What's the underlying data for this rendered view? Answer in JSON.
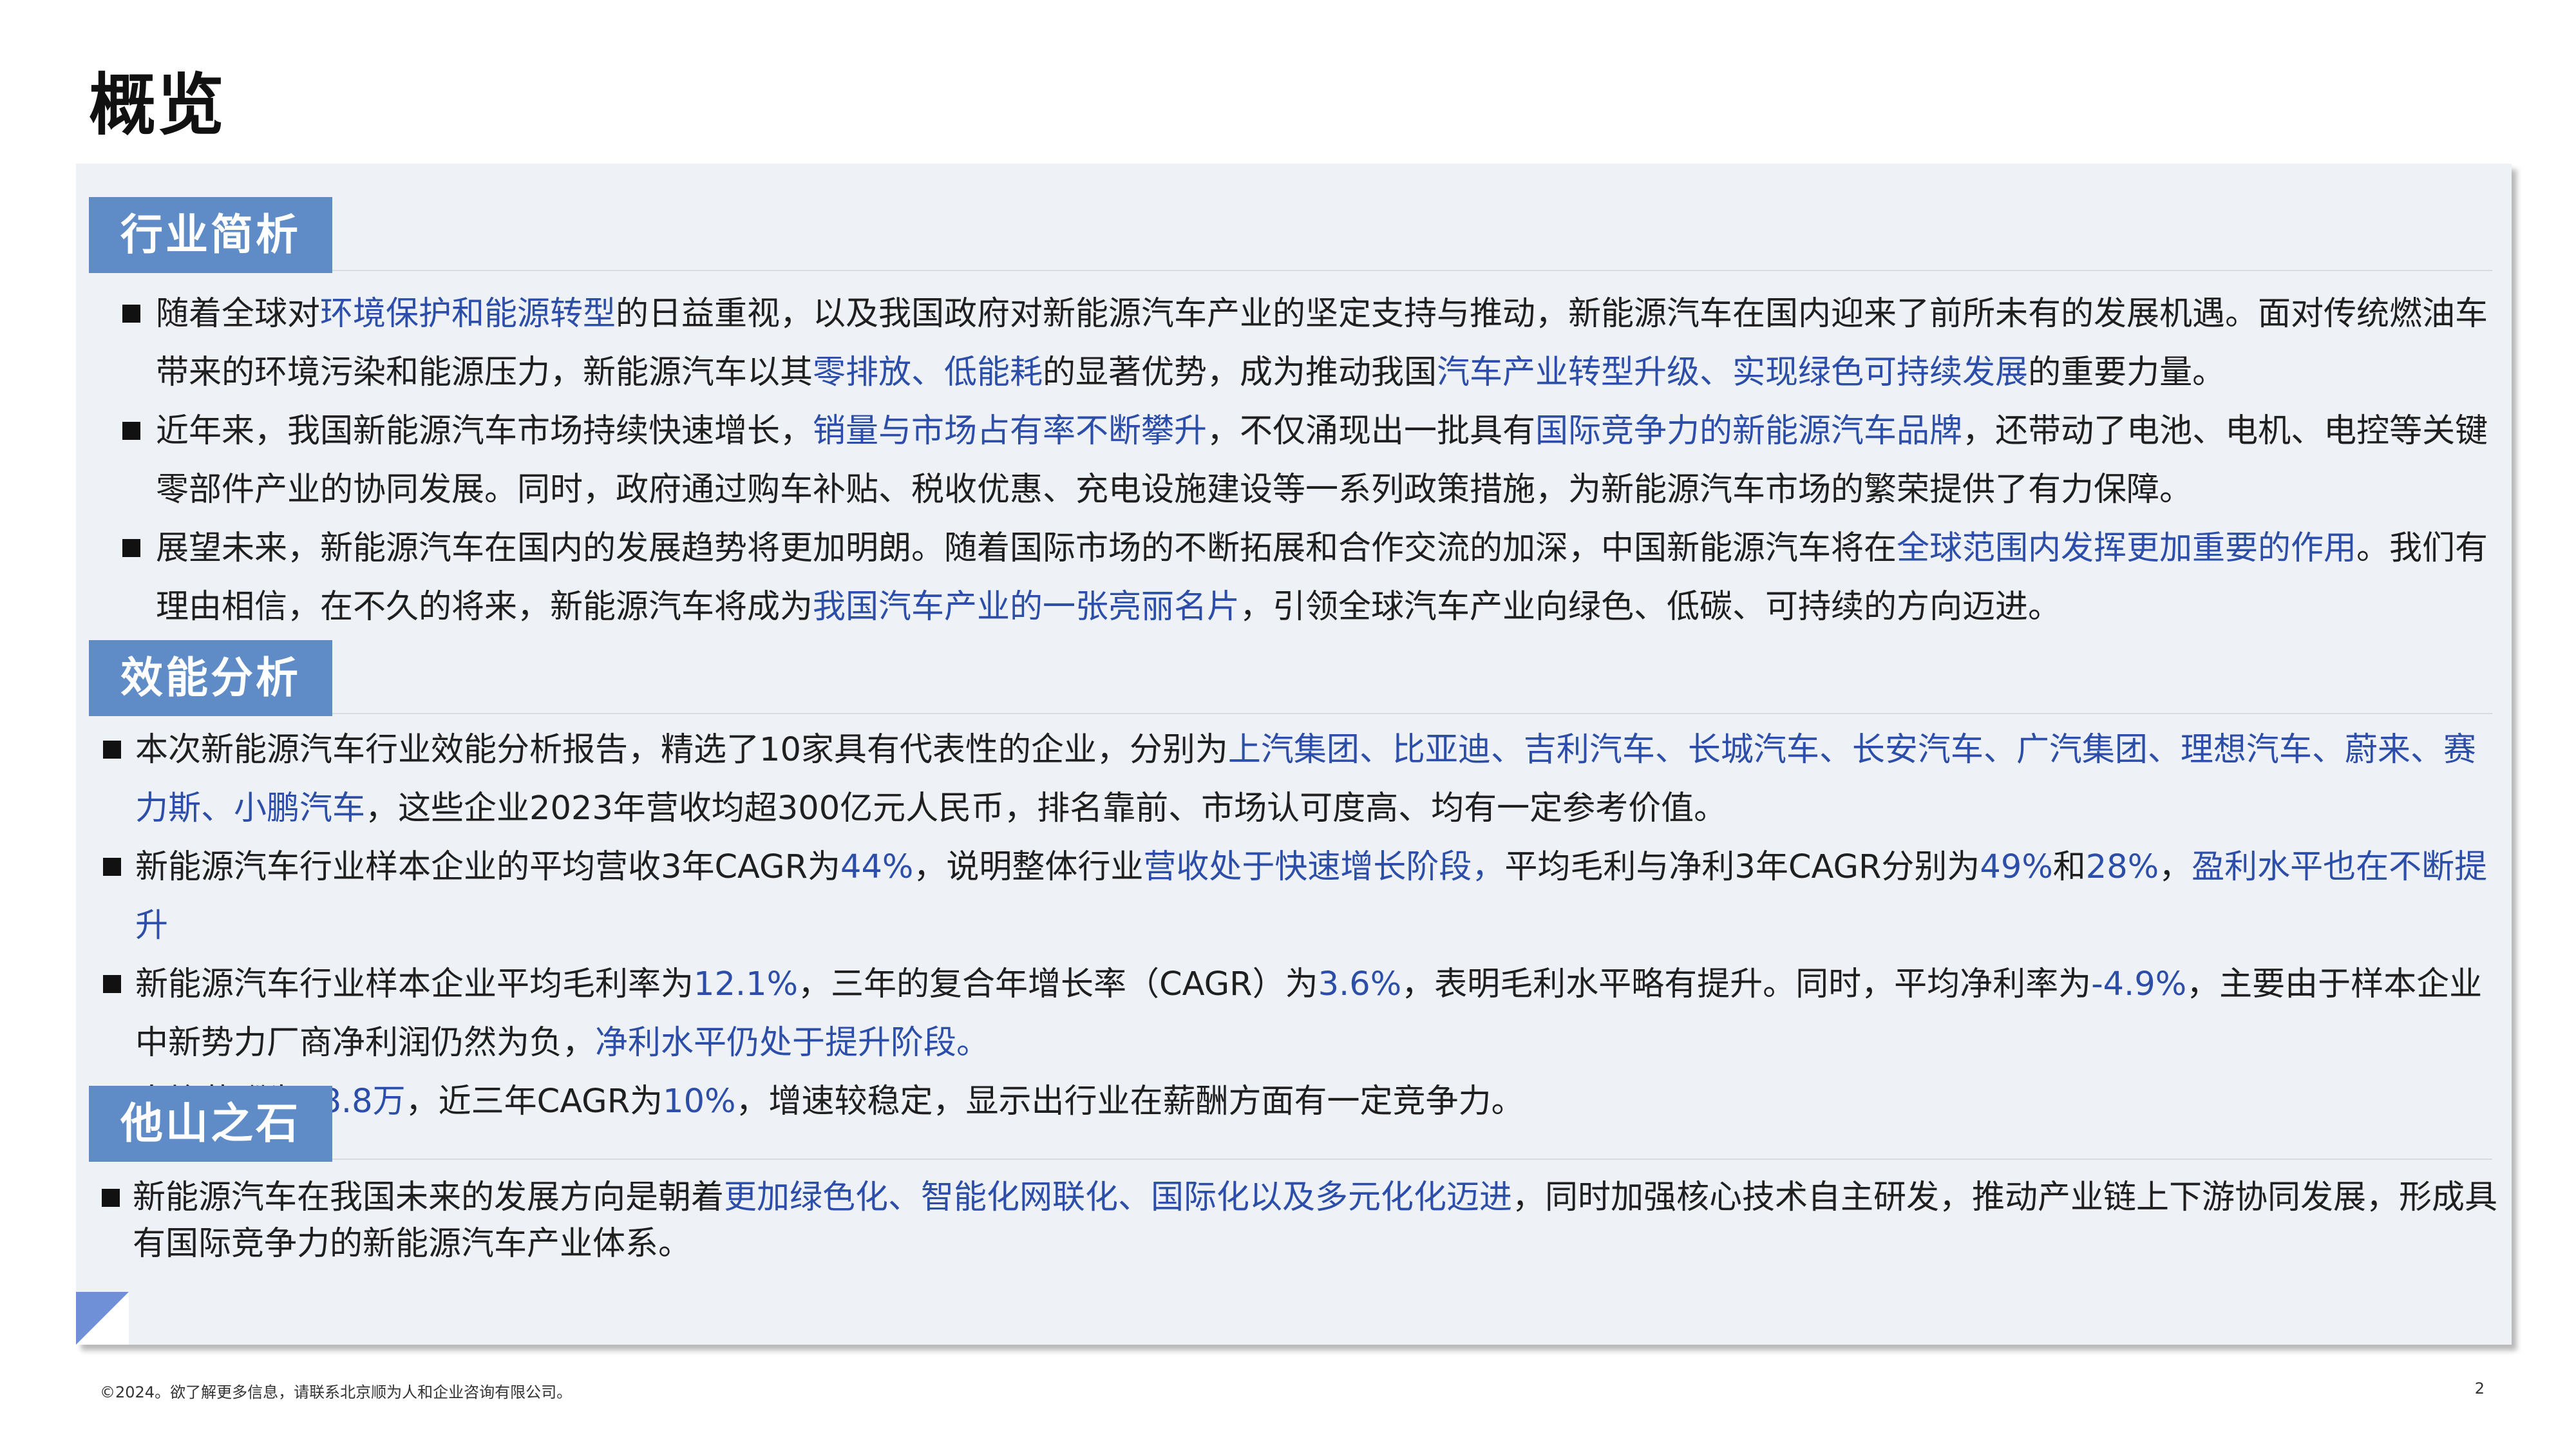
{
  "page": {
    "title": "概览"
  },
  "sections": [
    {
      "heading": "行业简析",
      "bullets": [
        [
          {
            "t": "随着全球对",
            "hl": false
          },
          {
            "t": "环境保护和能源转型",
            "hl": true
          },
          {
            "t": "的日益重视，以及我国政府对新能源汽车产业的坚定支持与推动，新能源汽车在国内迎来了前所未有的发展机遇。面对传统燃油车带来的环境污染和能源压力，新能源汽车以其",
            "hl": false
          },
          {
            "t": "零排放、低能耗",
            "hl": true
          },
          {
            "t": "的显著优势，成为推动我国",
            "hl": false
          },
          {
            "t": "汽车产业转型升级、实现绿色可持续发展",
            "hl": true
          },
          {
            "t": "的重要力量。",
            "hl": false
          }
        ],
        [
          {
            "t": "近年来，我国新能源汽车市场持续快速增长，",
            "hl": false
          },
          {
            "t": "销量与市场占有率不断攀升",
            "hl": true
          },
          {
            "t": "，不仅涌现出一批具有",
            "hl": false
          },
          {
            "t": "国际竞争力的新能源汽车品牌",
            "hl": true
          },
          {
            "t": "，还带动了电池、电机、电控等关键零部件产业的协同发展。同时，政府通过购车补贴、税收优惠、充电设施建设等一系列政策措施，为新能源汽车市场的繁荣提供了有力保障。",
            "hl": false
          }
        ],
        [
          {
            "t": "展望未来，新能源汽车在国内的发展趋势将更加明朗。随着国际市场的不断拓展和合作交流的加深，中国新能源汽车将在",
            "hl": false
          },
          {
            "t": "全球范围内发挥更加重要的作用",
            "hl": true
          },
          {
            "t": "。我们有理由相信，在不久的将来，新能源汽车将成为",
            "hl": false
          },
          {
            "t": "我国汽车产业的一张亮丽名片",
            "hl": true
          },
          {
            "t": "，引领全球汽车产业向绿色、低碳、可持续的方向迈进。",
            "hl": false
          }
        ]
      ]
    },
    {
      "heading": "效能分析",
      "bullets": [
        [
          {
            "t": "本次新能源汽车行业效能分析报告，精选了10家具有代表性的企业，分别为",
            "hl": false
          },
          {
            "t": "上汽集团、比亚迪、吉利汽车、长城汽车、长安汽车、广汽集团、理想汽车、蔚来、赛力斯、小鹏汽车",
            "hl": true
          },
          {
            "t": "，这些企业2023年营收均超300亿元人民币，排名靠前、市场认可度高、均有一定参考价值。",
            "hl": false
          }
        ],
        [
          {
            "t": "新能源汽车行业样本企业的平均营收3年CAGR为",
            "hl": false
          },
          {
            "t": "44%",
            "hl": true
          },
          {
            "t": "，说明整体行业",
            "hl": false
          },
          {
            "t": "营收处于快速增长阶段，",
            "hl": true
          },
          {
            "t": "平均毛利与净利3年CAGR分别为",
            "hl": false
          },
          {
            "t": "49%",
            "hl": true
          },
          {
            "t": "和",
            "hl": false
          },
          {
            "t": "28%",
            "hl": true
          },
          {
            "t": "，",
            "hl": false
          },
          {
            "t": "盈利水平也在不断提升",
            "hl": true
          }
        ],
        [
          {
            "t": "新能源汽车行业样本企业平均毛利率为",
            "hl": false
          },
          {
            "t": "12.1%",
            "hl": true
          },
          {
            "t": "，三年的复合年增长率（CAGR）为",
            "hl": false
          },
          {
            "t": "3.6%",
            "hl": true
          },
          {
            "t": "，表明毛利水平略有提升。同时，平均净利率为",
            "hl": false
          },
          {
            "t": "-4.9%",
            "hl": true
          },
          {
            "t": "，主要由于样本企业中新势力厂商净利润仍然为负，",
            "hl": false
          },
          {
            "t": "净利水平仍处于提升阶段。",
            "hl": true
          }
        ],
        [
          {
            "t": "人均薪酬为",
            "hl": false
          },
          {
            "t": "28.8万",
            "hl": true
          },
          {
            "t": "，近三年CAGR为",
            "hl": false
          },
          {
            "t": "10%",
            "hl": true
          },
          {
            "t": "，增速较稳定，显示出行业在薪酬方面有一定竞争力。",
            "hl": false
          }
        ]
      ]
    },
    {
      "heading": "他山之石",
      "bullets": [
        [
          {
            "t": "新能源汽车在我国未来的发展方向是朝着",
            "hl": false
          },
          {
            "t": "更加绿色化、智能化网联化、国际化以及多元化化迈进",
            "hl": true
          },
          {
            "t": "，同时加强核心技术自主研发，推动产业链上下游协同发展，形成具有国际竞争力的新能源汽车产业体系。",
            "hl": false
          }
        ]
      ]
    }
  ],
  "footer": {
    "copyright": "©2024。欲了解更多信息，请联系北京顺为人和企业咨询有限公司。",
    "page_number": "2"
  },
  "colors": {
    "accent": "#5f8cc7",
    "highlight_text": "#2c4ea8",
    "panel_bg": "#eef2f6"
  }
}
